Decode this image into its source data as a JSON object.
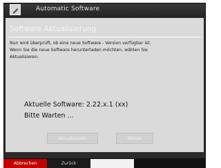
{
  "window": {
    "title": "Automatic Software",
    "logo_icon": "app-logo-icon"
  },
  "dialog": {
    "heading": "Software Aktualisierung",
    "info_lines": [
      "Nun wird überprüft, ob eine neue Software - Version verfügbar ist.",
      "Wenn Sie die neue Software herunterladen möchten, wählen Sie",
      "Aktualisieren."
    ],
    "version_text": "Aktuelle Software: 2.22.x.1 (xx)",
    "wait_text": "Bitte Warten ..."
  },
  "buttons": {
    "update_label": "Aktualisieren",
    "continue_label": "Weiter"
  },
  "softkeys": {
    "cancel_label": "Abbrechen",
    "back_label": "Zurück",
    "cancel_color": "#c30000"
  }
}
